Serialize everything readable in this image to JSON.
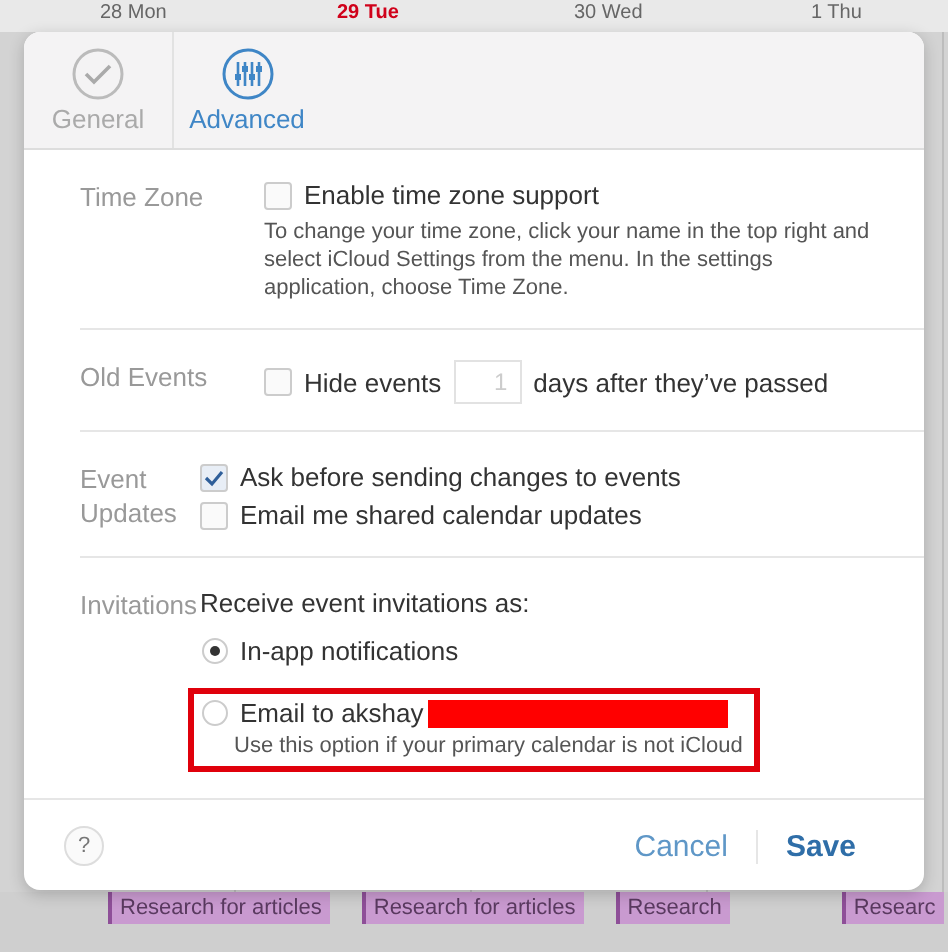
{
  "calendar": {
    "days": [
      {
        "label": "28 Mon",
        "today": false
      },
      {
        "label": "29 Tue",
        "today": true
      },
      {
        "label": "30 Wed",
        "today": false
      },
      {
        "label": "1 Thu",
        "today": false
      }
    ],
    "events": [
      "Research for articles",
      "Research for articles",
      "Research",
      "Researc"
    ]
  },
  "dialog": {
    "tabs": [
      {
        "label": "General",
        "selected": false
      },
      {
        "label": "Advanced",
        "selected": true
      }
    ],
    "sections": [
      {
        "label": "Time Zone",
        "items": [
          {
            "kind": "checkbox",
            "label": "Enable time zone support",
            "checked": false
          },
          {
            "kind": "note",
            "text": "To change your time zone, click your name in the top right and select iCloud Settings from the menu. In the settings application, choose Time Zone."
          }
        ]
      },
      {
        "label": "Old Events",
        "items": [
          {
            "kind": "checkbox-days",
            "label": "Hide events",
            "value": "1",
            "suffix": "days after they’ve passed",
            "checked": false
          }
        ]
      },
      {
        "label": "Event Updates",
        "items": [
          {
            "kind": "checkbox",
            "label": "Ask before sending changes to events",
            "checked": true
          },
          {
            "kind": "checkbox",
            "label": "Email me shared calendar updates",
            "checked": false
          }
        ]
      },
      {
        "label": "Invitations",
        "items": [
          {
            "kind": "heading",
            "text": "Receive event invitations as:"
          },
          {
            "kind": "radio",
            "label": "In-app notifications",
            "selected": true
          },
          {
            "kind": "radio",
            "label": "Email to akshay",
            "note": "Use this option if your primary calendar is not iCloud",
            "selected": false,
            "highlighted": true,
            "redacted": true
          }
        ]
      }
    ],
    "help": "?",
    "buttons": [
      {
        "label": "Cancel",
        "kind": "secondary"
      },
      {
        "label": "Save",
        "kind": "primary"
      }
    ]
  }
}
